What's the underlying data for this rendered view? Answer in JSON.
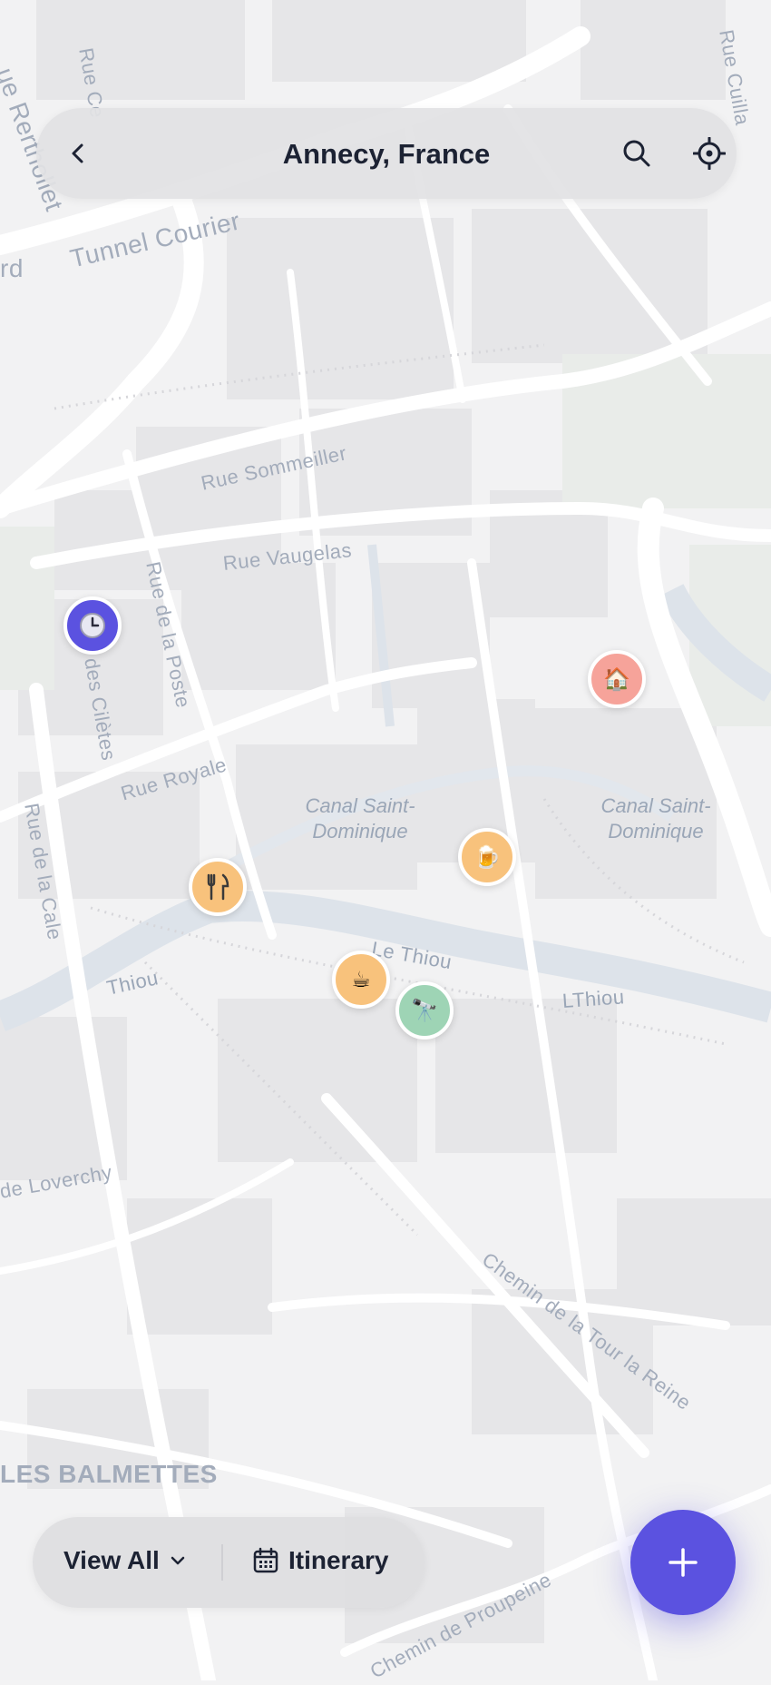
{
  "header": {
    "title": "Annecy, France",
    "back_icon": "chevron-left-icon",
    "search_icon": "search-icon",
    "locate_icon": "crosshair-icon"
  },
  "map": {
    "streets": [
      "Rue Sommeiller",
      "Rue Vaugelas",
      "Rue de la Poste",
      "Rue Royale",
      "des Cilètes",
      "Rue de la Cale",
      "Tunnel Courier",
      "de Loverchy",
      "Chemin de la Tour la Reine",
      "Chemin de Proupeine",
      "Rue Ce",
      "Rue Cuilla",
      "ue Rerthollet",
      "rd"
    ],
    "water": [
      "Canal Saint-Dominique",
      "Canal Saint-Dominique",
      "Le Thiou",
      "Thiou",
      "LThiou"
    ],
    "areas": [
      "LES BALMETTES"
    ]
  },
  "pins": [
    {
      "icon": "clock-icon",
      "glyph": "🕒",
      "color": "#5b52e0"
    },
    {
      "icon": "house-icon",
      "glyph": "🏠",
      "color": "#f6a39a"
    },
    {
      "icon": "beer-icon",
      "glyph": "🍺",
      "color": "#f8c27c"
    },
    {
      "icon": "fork-knife-icon",
      "glyph": "🍴",
      "color": "#f8c27c"
    },
    {
      "icon": "coffee-icon",
      "glyph": "☕",
      "color": "#f8c27c"
    },
    {
      "icon": "telescope-icon",
      "glyph": "🔭",
      "color": "#9ed4b5"
    }
  ],
  "bottom_bar": {
    "view_label": "View All",
    "view_icon": "chevron-down-icon",
    "itinerary_label": "Itinerary",
    "itinerary_icon": "calendar-icon"
  },
  "fab": {
    "icon": "plus-icon",
    "color": "#5b52e0"
  }
}
